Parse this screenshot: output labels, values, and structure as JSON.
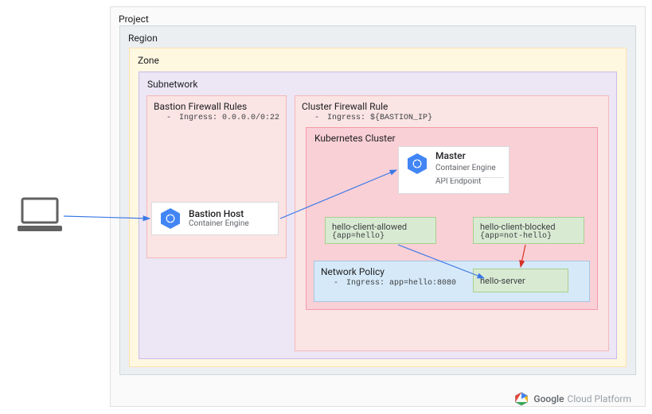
{
  "project": {
    "label": "Project"
  },
  "region": {
    "label": "Region"
  },
  "zone": {
    "label": "Zone"
  },
  "subnetwork": {
    "label": "Subnetwork"
  },
  "bastion_firewall": {
    "label": "Bastion Firewall Rules",
    "rule": "Ingress: 0.0.0.0/0:22"
  },
  "cluster_firewall": {
    "label": "Cluster Firewall Rule",
    "rule": "Ingress: ${BASTION_IP}"
  },
  "k8s": {
    "label": "Kubernetes Cluster"
  },
  "bastion_host": {
    "title": "Bastion Host",
    "subtitle": "Container Engine"
  },
  "master": {
    "title": "Master",
    "subtitle": "Container Engine",
    "endpoint": "API  Endpoint"
  },
  "pods": {
    "allowed": {
      "name": "hello-client-allowed",
      "meta": "{app=hello}"
    },
    "blocked": {
      "name": "hello-client-blocked",
      "meta": "{app=not-hello}"
    },
    "server": {
      "name": "hello-server"
    }
  },
  "netpol": {
    "label": "Network Policy",
    "rule": "Ingress: app=hello:8080"
  },
  "footer": {
    "brand1": "Google",
    "brand2": "Cloud Platform"
  },
  "colors": {
    "arrow_blue": "#3b78e7",
    "arrow_red": "#d93025"
  }
}
